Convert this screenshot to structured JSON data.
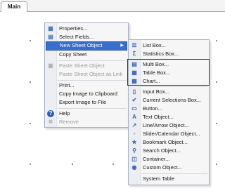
{
  "tabs": [
    {
      "label": "Main"
    }
  ],
  "context_menu": {
    "items": [
      {
        "label": "Properties...",
        "icon": "properties-icon",
        "enabled": true
      },
      {
        "label": "Select Fields...",
        "icon": "select-fields-icon",
        "enabled": true
      },
      {
        "label": "New Sheet Object",
        "icon": "",
        "enabled": true,
        "highlighted": true,
        "has_submenu": true
      },
      {
        "label": "Copy Sheet",
        "icon": "",
        "enabled": true
      },
      {
        "label": "Paste Sheet Object",
        "icon": "paste-icon",
        "enabled": false
      },
      {
        "label": "Paste Sheet Object as Link",
        "icon": "",
        "enabled": false
      },
      {
        "label": "Print...",
        "icon": "",
        "enabled": true
      },
      {
        "label": "Copy Image to Clipboard",
        "icon": "",
        "enabled": true
      },
      {
        "label": "Export Image to File",
        "icon": "",
        "enabled": true
      },
      {
        "label": "Help",
        "icon": "help-icon",
        "enabled": true
      },
      {
        "label": "Remove",
        "icon": "remove-icon",
        "enabled": false
      }
    ]
  },
  "submenu": {
    "items": [
      {
        "label": "List Box...",
        "icon": "list-box-icon"
      },
      {
        "label": "Statistics Box...",
        "icon": "statistics-icon"
      },
      {
        "label": "Multi Box...",
        "icon": "multi-box-icon"
      },
      {
        "label": "Table Box...",
        "icon": "table-box-icon"
      },
      {
        "label": "Chart...",
        "icon": "chart-icon"
      },
      {
        "label": "Input Box...",
        "icon": "input-box-icon"
      },
      {
        "label": "Current Selections Box...",
        "icon": "current-selections-icon"
      },
      {
        "label": "Button...",
        "icon": "button-icon"
      },
      {
        "label": "Text Object...",
        "icon": "text-object-icon"
      },
      {
        "label": "Line/Arrow Object...",
        "icon": "line-arrow-icon"
      },
      {
        "label": "Slider/Calendar Object...",
        "icon": "slider-calendar-icon"
      },
      {
        "label": "Bookmark Object...",
        "icon": "bookmark-icon"
      },
      {
        "label": "Search Object...",
        "icon": "search-icon"
      },
      {
        "label": "Container...",
        "icon": "container-icon"
      },
      {
        "label": "Custom Object...",
        "icon": "custom-object-icon"
      },
      {
        "label": "System Table",
        "icon": ""
      }
    ]
  },
  "colors": {
    "highlight": "#3a6fc9",
    "annotation_box": "#a3001f"
  }
}
